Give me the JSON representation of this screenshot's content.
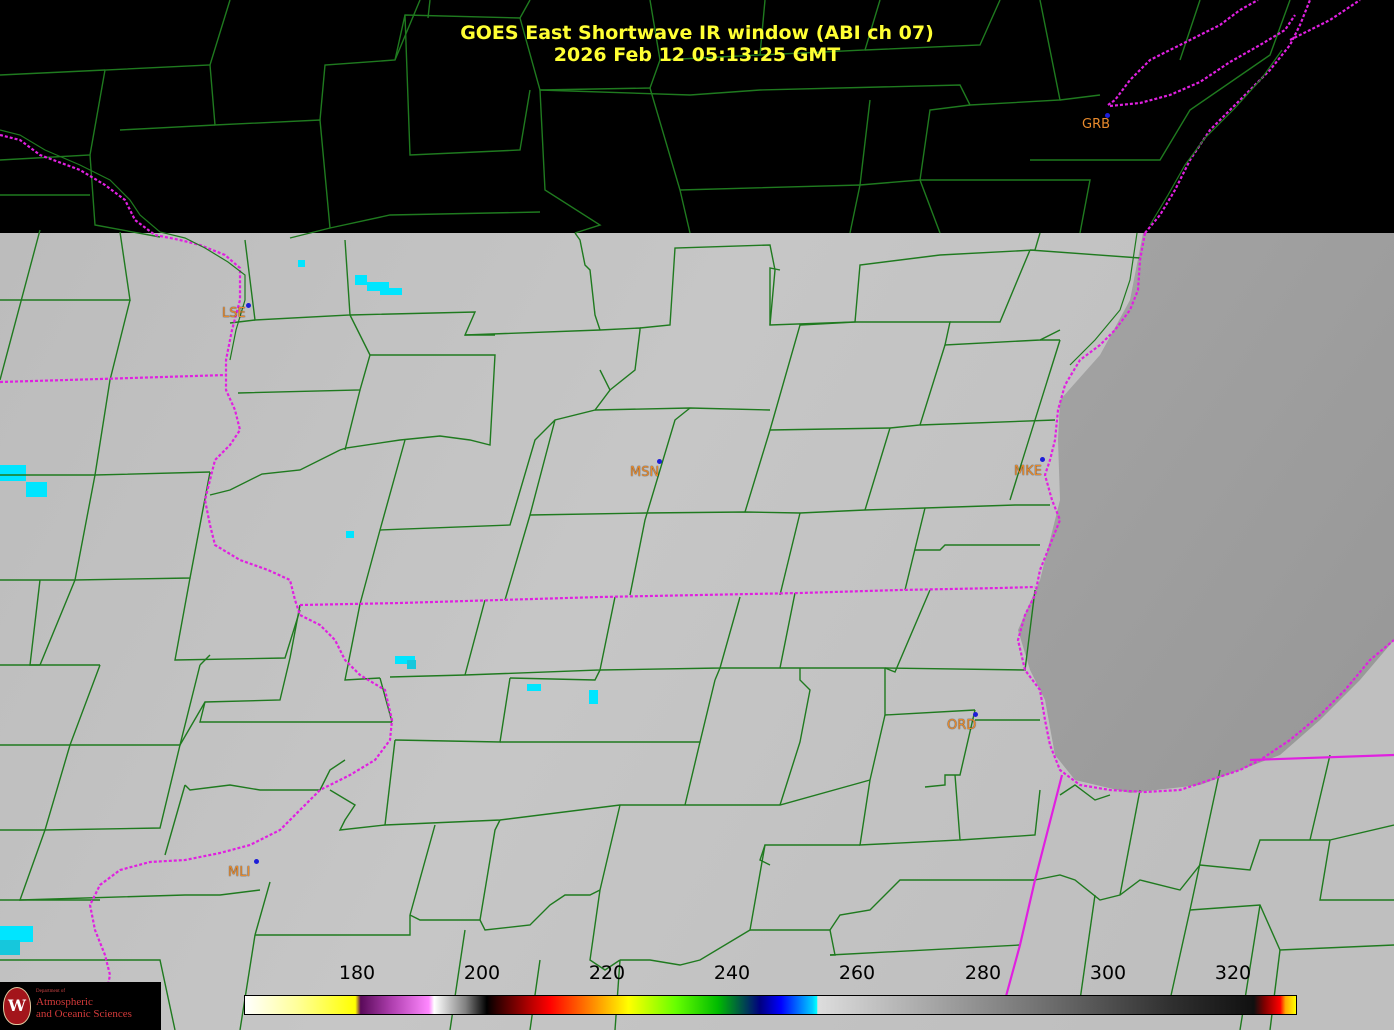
{
  "title": {
    "line1": "GOES East Shortwave IR window (ABI ch 07)",
    "line2": "2026 Feb 12  05:13:25 GMT"
  },
  "cities": [
    {
      "code": "GRB"
    },
    {
      "code": "LSE"
    },
    {
      "code": "MSN"
    },
    {
      "code": "MKE"
    },
    {
      "code": "ORD"
    },
    {
      "code": "MLI"
    }
  ],
  "colorbar": {
    "ticks": [
      "180",
      "200",
      "220",
      "240",
      "260",
      "280",
      "300",
      "320"
    ]
  },
  "logo": {
    "dept": "Department of",
    "line1": "Atmospheric",
    "line2": "and Oceanic Sciences",
    "seal_letter": "W"
  },
  "colors": {
    "county_border": "#1f7a1f",
    "state_border": "#e020e0",
    "title": "#ffff33",
    "city_label": "#e88a2c",
    "city_dot": "#1d1dd9",
    "land": "#c4c4c4",
    "lake": "#999999",
    "cold_cloud": "#00e5ff"
  }
}
